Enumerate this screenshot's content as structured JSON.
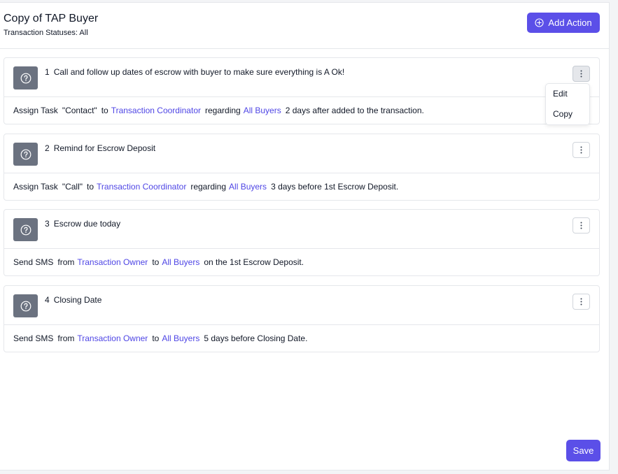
{
  "header": {
    "title": "Copy of TAP Buyer",
    "subtitle": "Transaction Statuses: All",
    "add_label": "Add Action"
  },
  "actions": [
    {
      "num": "1",
      "title": "Call and follow up dates of escrow with buyer to make sure everything is A Ok!",
      "parts": [
        "Assign Task",
        "\"Contact\"",
        "to",
        "Transaction Coordinator",
        "regarding",
        "All Buyers",
        "2 days after added to the transaction."
      ]
    },
    {
      "num": "2",
      "title": "Remind for Escrow Deposit",
      "parts": [
        "Assign Task",
        "\"Call\"",
        "to",
        "Transaction Coordinator",
        "regarding",
        "All Buyers",
        "3 days before 1st Escrow Deposit."
      ]
    },
    {
      "num": "3",
      "title": "Escrow due today",
      "parts": [
        "Send SMS",
        "from",
        "Transaction Owner",
        "to",
        "All Buyers",
        "on the 1st Escrow Deposit."
      ]
    },
    {
      "num": "4",
      "title": "Closing Date",
      "parts": [
        "Send SMS",
        "from",
        "Transaction Owner",
        "to",
        "All Buyers",
        "5 days before Closing Date."
      ]
    }
  ],
  "menu": {
    "edit_label": "Edit",
    "copy_label": "Copy"
  },
  "footer": {
    "save_label": "Save"
  },
  "colors": {
    "accent": "#5b4fe8",
    "link": "#4f46e5",
    "icon_bg": "#6b7280"
  }
}
